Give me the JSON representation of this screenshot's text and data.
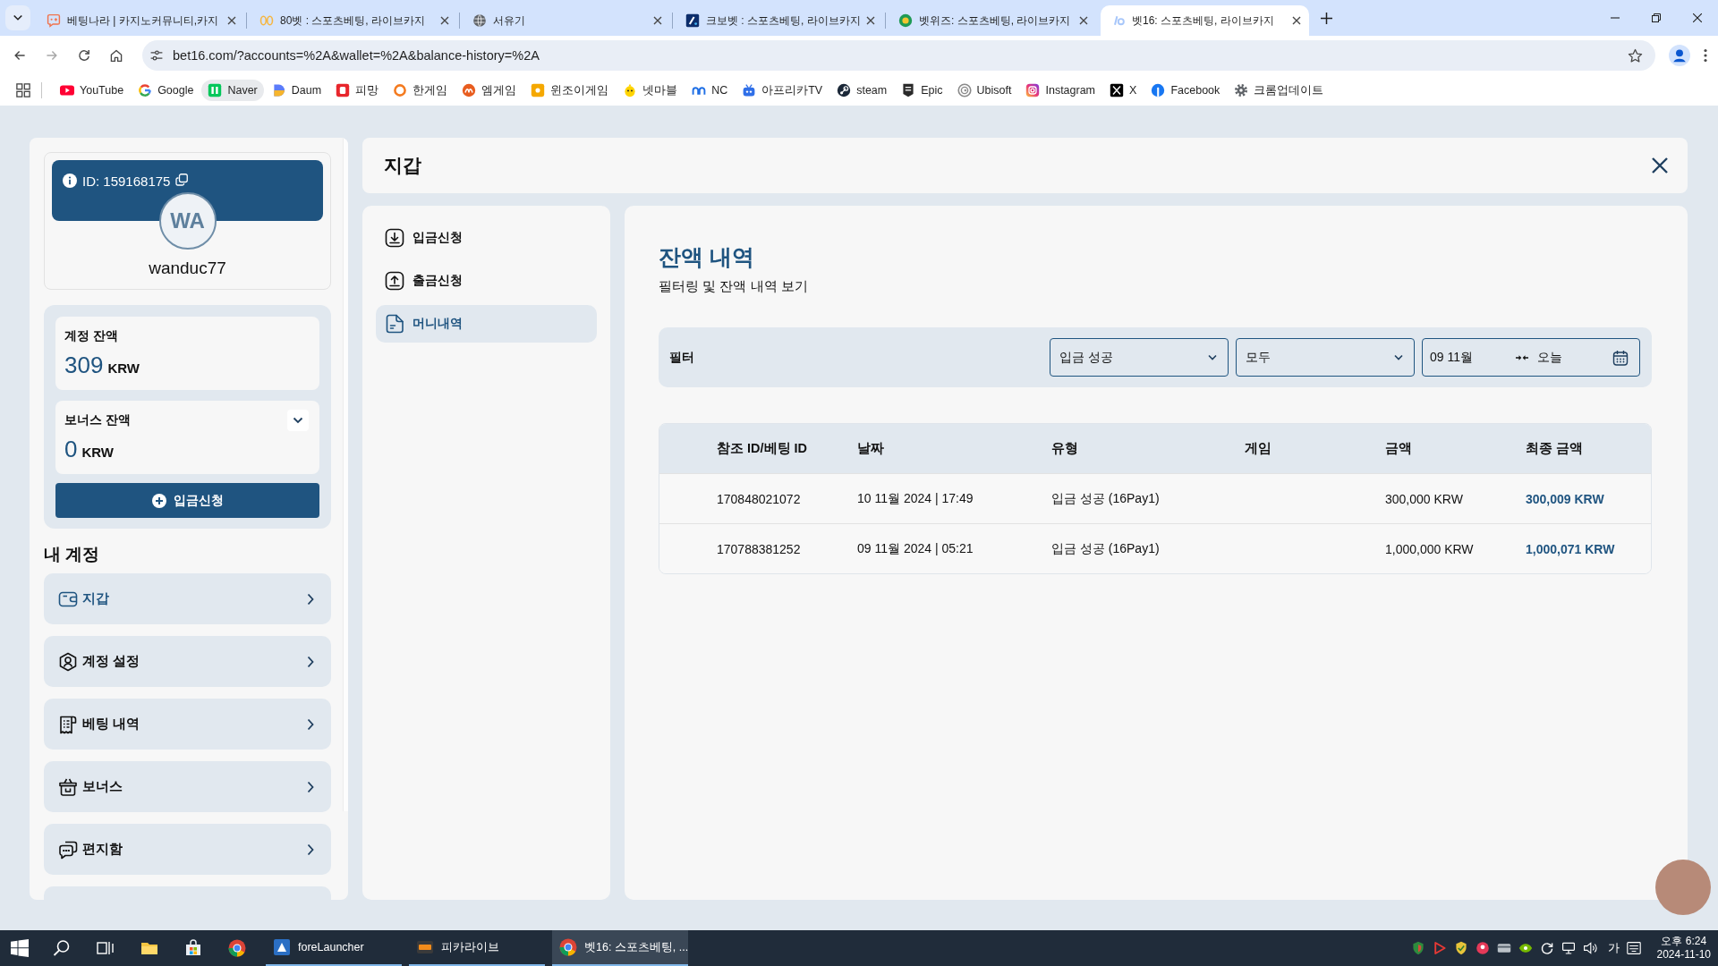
{
  "browser": {
    "tabs": [
      {
        "title": "베팅나라 | 카지노커뮤니티,카지",
        "kind": "chat",
        "selected": false
      },
      {
        "title": "80벳 : 스포츠베팅, 라이브카지",
        "kind": "rings",
        "selected": false
      },
      {
        "title": "서유기",
        "kind": "globe",
        "selected": false
      },
      {
        "title": "크보벳 : 스포츠베팅, 라이브카지",
        "kind": "slash",
        "selected": false
      },
      {
        "title": "벳위즈: 스포츠베팅, 라이브카지",
        "kind": "disc",
        "selected": false
      },
      {
        "title": "벳16: 스포츠베팅, 라이브카지",
        "kind": "mark",
        "selected": true
      }
    ],
    "url": "bet16.com/?accounts=%2A&wallet=%2A&balance-history=%2A",
    "bookmarks": [
      {
        "label": "YouTube",
        "kind": "play",
        "hovered": false
      },
      {
        "label": "Google",
        "kind": "gring",
        "hovered": false
      },
      {
        "label": "Naver",
        "kind": "greensq",
        "hovered": true
      },
      {
        "label": "Daum",
        "kind": "halfdisc",
        "hovered": false
      },
      {
        "label": "피망",
        "kind": "redsq",
        "hovered": false
      },
      {
        "label": "한게임",
        "kind": "oring",
        "hovered": false
      },
      {
        "label": "엠게임",
        "kind": "odisc",
        "hovered": false
      },
      {
        "label": "윈조이게임",
        "kind": "ambersq",
        "hovered": false
      },
      {
        "label": "넷마블",
        "kind": "mascot",
        "hovered": false
      },
      {
        "label": "NC",
        "kind": "arches",
        "hovered": false
      },
      {
        "label": "아프리카TV",
        "kind": "tv",
        "hovered": false
      },
      {
        "label": "steam",
        "kind": "steam",
        "hovered": false
      },
      {
        "label": "Epic",
        "kind": "shield",
        "hovered": false
      },
      {
        "label": "Ubisoft",
        "kind": "swirl",
        "hovered": false
      },
      {
        "label": "Instagram",
        "kind": "camera",
        "hovered": false
      },
      {
        "label": "X",
        "kind": "cross",
        "hovered": false
      },
      {
        "label": "Facebook",
        "kind": "bluedisc",
        "hovered": false
      },
      {
        "label": "크롬업데이트",
        "kind": "gear",
        "hovered": false
      }
    ]
  },
  "profile": {
    "id_label": "ID: 159168175",
    "initials": "WA",
    "username": "wanduc77"
  },
  "balances": [
    {
      "label": "계정 잔액",
      "amount": "309",
      "currency": "KRW",
      "collapsible": false
    },
    {
      "label": "보너스 잔액",
      "amount": "0",
      "currency": "KRW",
      "collapsible": true
    }
  ],
  "deposit_button": "입금신청",
  "account_menu": {
    "heading": "내 계정",
    "items": [
      {
        "label": "지갑",
        "kind": "wallet",
        "selected": true
      },
      {
        "label": "계정 설정",
        "kind": "user",
        "selected": false
      },
      {
        "label": "베팅 내역",
        "kind": "receipt",
        "selected": false
      },
      {
        "label": "보너스",
        "kind": "gift",
        "selected": false
      },
      {
        "label": "편지함",
        "kind": "chat",
        "selected": false
      }
    ],
    "partially_hidden_item": true
  },
  "wallet": {
    "title": "지갑",
    "submenu": [
      {
        "label": "입금신청",
        "kind": "download",
        "selected": false
      },
      {
        "label": "출금신청",
        "kind": "upload",
        "selected": false
      },
      {
        "label": "머니내역",
        "kind": "document",
        "selected": true
      }
    ],
    "section": {
      "title": "잔액 내역",
      "subtitle": "필터링 및 잔액 내역 보기",
      "filter": {
        "label": "필터",
        "status": "입금 성공",
        "game": "모두",
        "date_from": "09 11월",
        "date_to": "오늘"
      },
      "table": {
        "columns": [
          "참조 ID/베팅 ID",
          "날짜",
          "유형",
          "게임",
          "금액",
          "최종 금액"
        ],
        "rows": [
          {
            "ref_id": "170848021072",
            "date": "10 11월 2024 | 17:49",
            "type": "입금 성공 (16Pay1)",
            "amount": "300,000 KRW",
            "final_amount": "300,009 KRW"
          },
          {
            "ref_id": "170788381252",
            "date": "09 11월 2024 | 05:21",
            "type": "입금 성공 (16Pay1)",
            "amount": "1,000,000 KRW",
            "final_amount": "1,000,071 KRW"
          }
        ]
      }
    }
  },
  "taskbar": {
    "pinned": [
      {
        "kind": "start"
      },
      {
        "kind": "search"
      },
      {
        "kind": "taskview"
      },
      {
        "kind": "folder"
      },
      {
        "kind": "store"
      },
      {
        "kind": "browser"
      }
    ],
    "windows": [
      {
        "label": "foreLauncher",
        "kind": "launcher",
        "selected": false
      },
      {
        "label": "피카라이브",
        "kind": "pika",
        "selected": false
      },
      {
        "label": "벳16: 스포츠베팅, ...",
        "kind": "browser",
        "selected": true
      }
    ],
    "tray": [
      {
        "kind": "shield"
      },
      {
        "kind": "play"
      },
      {
        "kind": "badge"
      },
      {
        "kind": "pdisc"
      },
      {
        "kind": "card"
      },
      {
        "kind": "eye"
      },
      {
        "kind": "circlearrow"
      },
      {
        "kind": "network"
      },
      {
        "kind": "volume"
      }
    ],
    "ime": "가",
    "time": "오후 6:24",
    "date": "2024-11-10"
  }
}
